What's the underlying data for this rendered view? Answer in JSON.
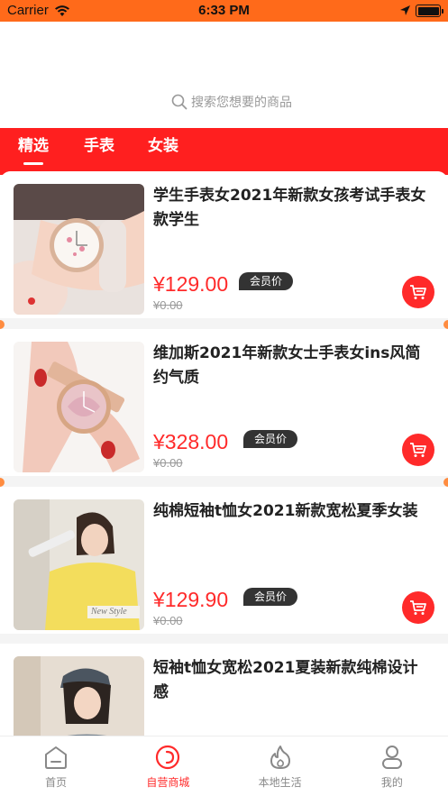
{
  "status_bar": {
    "carrier": "Carrier",
    "time": "6:33 PM"
  },
  "search": {
    "placeholder": "搜索您想要的商品"
  },
  "tabs": [
    {
      "label": "精选",
      "active": true
    },
    {
      "label": "手表",
      "active": false
    },
    {
      "label": "女装",
      "active": false
    }
  ],
  "products": [
    {
      "title": "学生手表女2021年新款女孩考试手表女款学生",
      "price": "¥129.00",
      "member_tag": "会员价",
      "original_price": "¥0.00"
    },
    {
      "title": "维加斯2021年新款女士手表女ins风简约气质",
      "price": "¥328.00",
      "member_tag": "会员价",
      "original_price": "¥0.00"
    },
    {
      "title": "纯棉短袖t恤女2021新款宽松夏季女装",
      "price": "¥129.90",
      "member_tag": "会员价",
      "original_price": "¥0.00",
      "image_caption": "New Style"
    },
    {
      "title": "短袖t恤女宽松2021夏装新款纯棉设计感"
    }
  ],
  "bottom_nav": [
    {
      "label": "首页",
      "icon": "home-icon",
      "active": false
    },
    {
      "label": "自营商城",
      "icon": "mall-icon",
      "active": true
    },
    {
      "label": "本地生活",
      "icon": "flame-icon",
      "active": false
    },
    {
      "label": "我的",
      "icon": "user-icon",
      "active": false
    }
  ],
  "colors": {
    "status_bar": "#ff6a1a",
    "tab_bar": "#ff1f1f",
    "accent": "#ff2a2a"
  }
}
